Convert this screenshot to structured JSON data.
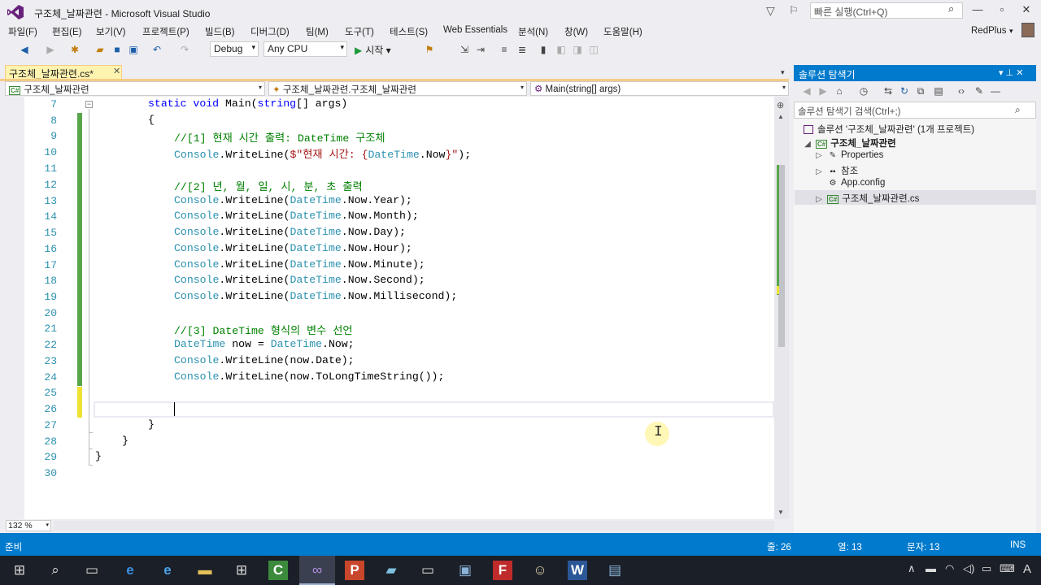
{
  "window": {
    "title": "구조체_날짜관련 - Microsoft Visual Studio",
    "quick_launch_placeholder": "빠른 실행(Ctrl+Q)",
    "minimize": "—",
    "maximize": "▫",
    "close": "✕"
  },
  "menu": [
    "파일(F)",
    "편집(E)",
    "보기(V)",
    "프로젝트(P)",
    "빌드(B)",
    "디버그(D)",
    "팀(M)",
    "도구(T)",
    "테스트(S)",
    "Web Essentials",
    "분석(N)",
    "창(W)",
    "도움말(H)"
  ],
  "user": {
    "name": "RedPlus",
    "dropdown": "▾"
  },
  "toolbar": {
    "config": "Debug",
    "platform": "Any CPU",
    "start_label": "시작",
    "arrow": "▾"
  },
  "doc_tab": {
    "label": "구조체_날짜관련.cs*",
    "close": "✕",
    "pin": "⊼"
  },
  "nav_bar": {
    "project": "구조체_날짜관련",
    "type": "구조체_날짜관련.구조체_날짜관련",
    "member": "Main(string[] args)"
  },
  "editor": {
    "line_numbers": [
      "7",
      "8",
      "9",
      "10",
      "11",
      "12",
      "13",
      "14",
      "15",
      "16",
      "17",
      "18",
      "19",
      "20",
      "21",
      "22",
      "23",
      "24",
      "25",
      "26",
      "27",
      "28",
      "29",
      "30"
    ],
    "lines": {
      "l7a": "static",
      "l7b": "void",
      "l7c": " Main(",
      "l7d": "string",
      "l7e": "[] args)",
      "l8": "{",
      "l9": "//[1] 현재 시간 출력: DateTime 구조체",
      "l10a": "Console",
      "l10b": ".WriteLine(",
      "l10c": "$\"현재 시간: {",
      "l10d": "DateTime",
      "l10e": ".Now",
      "l10f": "}\"",
      "l10g": ");",
      "l12": "//[2] 년, 월, 일, 시, 분, 초 출력",
      "l13": "Year",
      "l14": "Month",
      "l15": "Day",
      "l16": "Hour",
      "l17": "Minute",
      "l18": "Second",
      "l19": "Millisecond",
      "console": "Console",
      "writeline": ".WriteLine(",
      "datetime": "DateTime",
      "now_dot": ".Now.",
      "close_paren": ");",
      "l21": "//[3] DateTime 형식의 변수 선언",
      "l22a": "DateTime",
      "l22b": " now = ",
      "l22c": "DateTime",
      "l22d": ".Now;",
      "l23b": ".WriteLine(now.Date);",
      "l24b": ".WriteLine(now.ToLongTimeString());",
      "l27": "}",
      "l28": "}",
      "l29": "}"
    },
    "zoom": "132 %"
  },
  "solution_explorer": {
    "title": "솔루션 탐색기",
    "header_buttons": "▾ ⊥ ✕",
    "search_placeholder": "솔루션 탐색기 검색(Ctrl+;)",
    "tree": [
      {
        "label": "솔루션 '구조체_날짜관련' (1개 프로젝트)"
      },
      {
        "label": "구조체_날짜관련"
      },
      {
        "label": "Properties"
      },
      {
        "label": "참조"
      },
      {
        "label": "App.config"
      },
      {
        "label": "구조체_날짜관련.cs"
      }
    ],
    "cs_badge": "C#"
  },
  "status_bar": {
    "ready": "준비",
    "line": "줄: 26",
    "column": "열: 13",
    "char": "문자: 13",
    "mode": "INS"
  },
  "taskbar": {
    "lang": "A"
  },
  "colors": {
    "accent": "#007acc",
    "keyword": "#0000ff",
    "type": "#2b91af",
    "comment": "#008000",
    "string": "#a31515"
  }
}
